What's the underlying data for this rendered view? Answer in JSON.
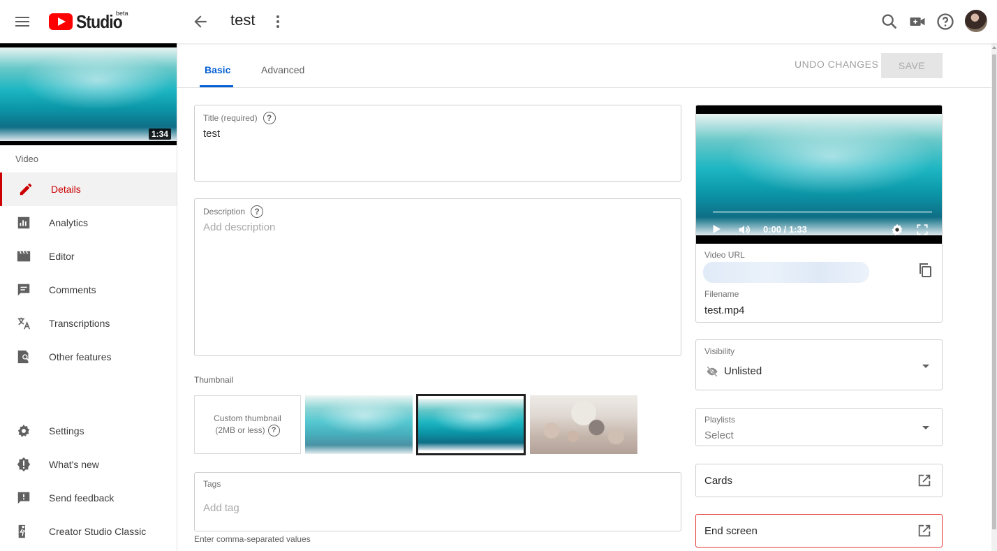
{
  "app": {
    "brand": "Studio",
    "brand_badge": "beta",
    "accent": "#cc0000",
    "link_color": "#065fd4"
  },
  "header": {
    "page_title": "test",
    "icons": [
      "menu-icon",
      "back-arrow-icon",
      "more-vert-icon",
      "search-icon",
      "create-video-icon",
      "help-icon",
      "avatar"
    ]
  },
  "sidebar": {
    "thumbnail_duration": "1:34",
    "section_label": "Video",
    "items": [
      {
        "label": "Details",
        "icon": "pencil-icon",
        "active": true
      },
      {
        "label": "Analytics",
        "icon": "bar-chart-icon"
      },
      {
        "label": "Editor",
        "icon": "clapperboard-icon"
      },
      {
        "label": "Comments",
        "icon": "comment-icon"
      },
      {
        "label": "Transcriptions",
        "icon": "translate-icon"
      },
      {
        "label": "Other features",
        "icon": "other-features-icon"
      }
    ],
    "bottom_items": [
      {
        "label": "Settings",
        "icon": "gear-icon"
      },
      {
        "label": "What's new",
        "icon": "alert-badge-icon"
      },
      {
        "label": "Send feedback",
        "icon": "feedback-icon"
      },
      {
        "label": "Creator Studio Classic",
        "icon": "exit-icon"
      }
    ]
  },
  "tabs": [
    {
      "label": "Basic",
      "active": true
    },
    {
      "label": "Advanced"
    }
  ],
  "actions": {
    "undo": "UNDO CHANGES",
    "save": "SAVE"
  },
  "form": {
    "title": {
      "label": "Title (required)",
      "value": "test"
    },
    "description": {
      "label": "Description",
      "placeholder": "Add description"
    },
    "thumbnail": {
      "label": "Thumbnail",
      "custom_line1": "Custom thumbnail",
      "custom_line2": "(2MB or less)",
      "selected_index": 1
    },
    "tags": {
      "label": "Tags",
      "placeholder": "Add tag",
      "hint": "Enter comma-separated values"
    }
  },
  "preview": {
    "time": "0:00 / 1:33",
    "video_url_label": "Video URL",
    "filename_label": "Filename",
    "filename": "test.mp4"
  },
  "visibility": {
    "label": "Visibility",
    "value": "Unlisted"
  },
  "playlists": {
    "label": "Playlists",
    "value": "Select"
  },
  "cards": {
    "label": "Cards"
  },
  "end_screen": {
    "label": "End screen",
    "highlight_color": "#e53935"
  }
}
